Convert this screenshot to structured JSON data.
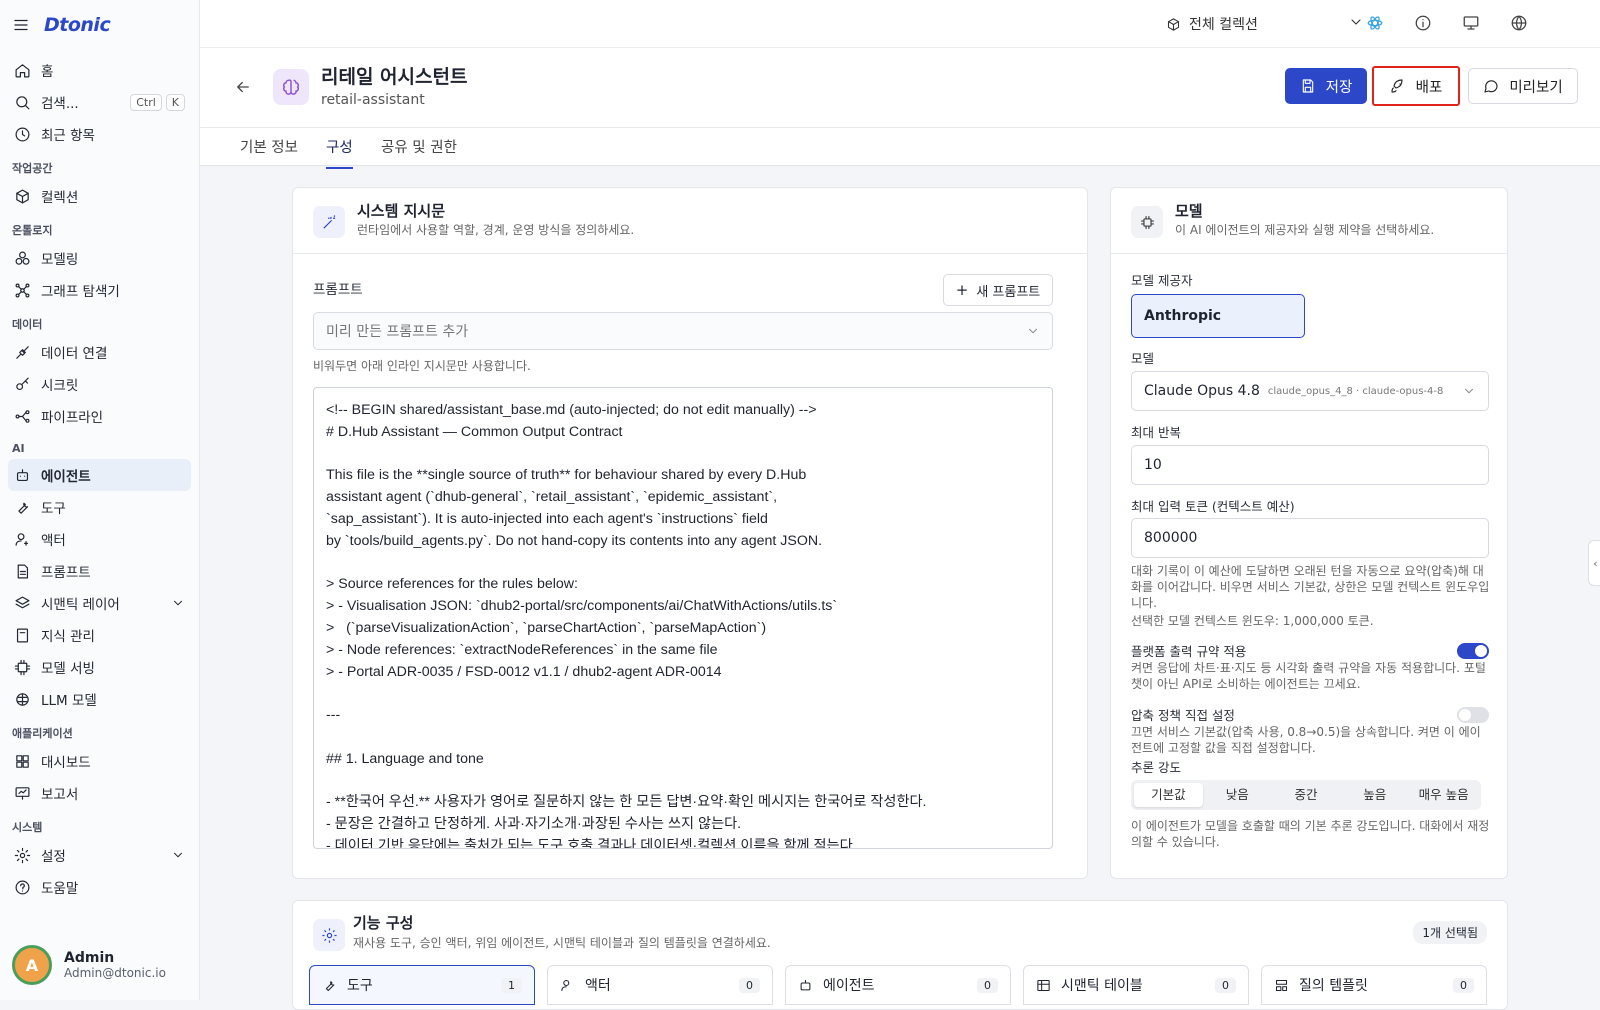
{
  "app": {
    "logo": "Dtonic"
  },
  "sidebar": {
    "items_top": [
      {
        "label": "홈",
        "icon": "home-icon"
      },
      {
        "label": "검색...",
        "icon": "search-icon",
        "kbd1": "Ctrl",
        "kbd2": "K"
      },
      {
        "label": "최근 항목",
        "icon": "clock-icon"
      }
    ],
    "sections": {
      "workspace": "작업공간",
      "ontology": "온톨로지",
      "data": "데이터",
      "ai": "AI",
      "apps": "애플리케이션",
      "system": "시스템"
    },
    "items": {
      "collection": "컬렉션",
      "modeling": "모델링",
      "graph": "그래프 탐색기",
      "data_conn": "데이터 연결",
      "secret": "시크릿",
      "pipeline": "파이프라인",
      "agent": "에이전트",
      "tool": "도구",
      "actor": "액터",
      "prompt": "프롬프트",
      "semantic": "시맨틱 레이어",
      "knowledge": "지식 관리",
      "model_serving": "모델 서빙",
      "llm": "LLM 모델",
      "dashboard": "대시보드",
      "report": "보고서",
      "settings": "설정",
      "help": "도움말"
    },
    "user": {
      "name": "Admin",
      "email": "Admin@dtonic.io"
    }
  },
  "topbar": {
    "collection": "전체 컬렉션"
  },
  "header": {
    "title": "리테일 어시스턴트",
    "slug": "retail-assistant",
    "save": "저장",
    "deploy": "배포",
    "preview": "미리보기"
  },
  "tabs": [
    "기본 정보",
    "구성",
    "공유 및 권한"
  ],
  "system": {
    "title": "시스템 지시문",
    "subtitle": "런타임에서 사용할 역할, 경계, 운영 방식을 정의하세요.",
    "prompt_label": "프롬프트",
    "new_prompt": "새 프롬프트",
    "select_placeholder": "미리 만든 프롬프트 추가",
    "hint": "비워두면 아래 인라인 지시문만 사용합니다.",
    "text": "<!-- BEGIN shared/assistant_base.md (auto-injected; do not edit manually) -->\n# D.Hub Assistant — Common Output Contract\n\nThis file is the **single source of truth** for behaviour shared by every D.Hub\nassistant agent (`dhub-general`, `retail_assistant`, `epidemic_assistant`,\n`sap_assistant`). It is auto-injected into each agent's `instructions` field\nby `tools/build_agents.py`. Do not hand-copy its contents into any agent JSON.\n\n> Source references for the rules below:\n> - Visualisation JSON: `dhub2-portal/src/components/ai/ChatWithActions/utils.ts`\n>   (`parseVisualizationAction`, `parseChartAction`, `parseMapAction`)\n> - Node references: `extractNodeReferences` in the same file\n> - Portal ADR-0035 / FSD-0012 v1.1 / dhub2-agent ADR-0014\n\n---\n\n## 1. Language and tone\n\n- **한국어 우선.** 사용자가 영어로 질문하지 않는 한 모든 답변·요약·확인 메시지는 한국어로 작성한다.\n- 문장은 간결하고 단정하게. 사과·자기소개·과장된 수사는 쓰지 않는다.\n- 데이터 기반 응답에는 출처가 되는 도구 호출 결과나 데이터셋·컬렉션 이름을 함께 적는다."
  },
  "model": {
    "title": "모델",
    "subtitle": "이 AI 에이전트의 제공자와 실행 제약을 선택하세요.",
    "provider_label": "모델 제공자",
    "provider": "Anthropic",
    "model_label": "모델",
    "model_name": "Claude Opus 4.8",
    "model_id": "claude_opus_4_8 · claude-opus-4-8",
    "max_iter_label": "최대 반복",
    "max_iter": "10",
    "max_tokens_label": "최대 입력 토큰 (컨텍스트 예산)",
    "max_tokens": "800000",
    "tokens_hint": "대화 기록이 이 예산에 도달하면 오래된 턴을 자동으로 요약(압축)해 대화를 이어갑니다. 비우면 서비스 기본값, 상한은 모델 컨텍스트 윈도우입니다.",
    "context_window": "선택한 모델 컨텍스트 윈도우: 1,000,000 토큰.",
    "platform_label": "플랫폼 출력 규약 적용",
    "platform_on": true,
    "platform_hint": "켜면 응답에 차트·표·지도 등 시각화 출력 규약을 자동 적용합니다. 포털 챗이 아닌 API로 소비하는 에이전트는 끄세요.",
    "compress_label": "압축 정책 직접 설정",
    "compress_on": false,
    "compress_hint": "끄면 서비스 기본값(압축 사용, 0.8→0.5)을 상속합니다. 켜면 이 에이전트에 고정할 값을 직접 설정합니다.",
    "reasoning_label": "추론 강도",
    "reasoning_options": [
      "기본값",
      "낮음",
      "중간",
      "높음",
      "매우 높음"
    ],
    "reasoning_selected": "기본값",
    "reasoning_hint": "이 에이전트가 모델을 호출할 때의 기본 추론 강도입니다. 대화에서 재정의할 수 있습니다."
  },
  "features": {
    "title": "기능 구성",
    "subtitle": "재사용 도구, 승인 액터, 위임 에이전트, 시맨틱 테이블과 질의 템플릿을 연결하세요.",
    "selected": "1개 선택됨",
    "tabs": [
      {
        "label": "도구",
        "count": "1"
      },
      {
        "label": "액터",
        "count": "0"
      },
      {
        "label": "에이전트",
        "count": "0"
      },
      {
        "label": "시맨틱 테이블",
        "count": "0"
      },
      {
        "label": "질의 템플릿",
        "count": "0"
      }
    ]
  },
  "colors": {
    "primary": "#2c48c9",
    "highlight": "#e0241b",
    "active_bg": "#e9eff9"
  }
}
